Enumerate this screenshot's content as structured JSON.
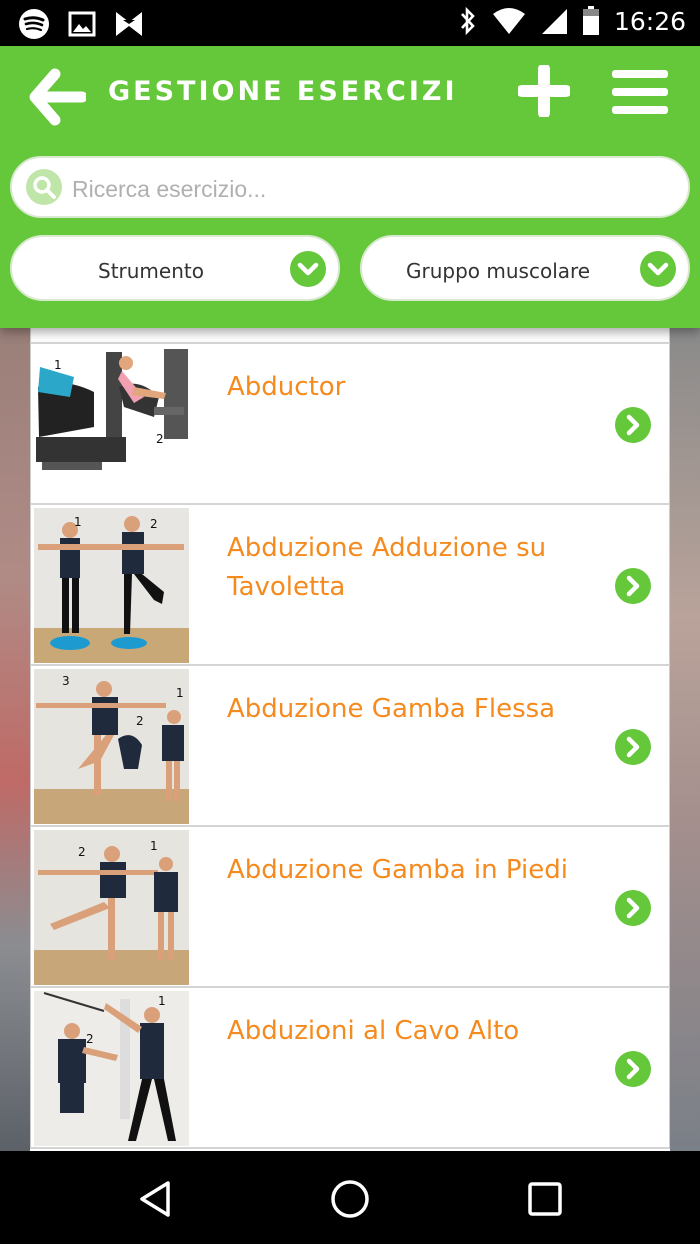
{
  "status_bar": {
    "time": "16:26",
    "icons": [
      "spotify-icon",
      "image-icon",
      "app-icon",
      "bluetooth-icon",
      "wifi-icon",
      "signal-icon",
      "battery-icon"
    ]
  },
  "header": {
    "title": "GESTIONE ESERCIZI",
    "background_color": "#65c73a",
    "icons": [
      "back-arrow-icon",
      "plus-icon",
      "hamburger-menu-icon"
    ]
  },
  "search": {
    "placeholder": "Ricerca esercizio...",
    "value": "",
    "icon": "search-icon"
  },
  "filters": [
    {
      "label": "Strumento",
      "icon": "chevron-down-icon"
    },
    {
      "label": "Gruppo muscolare",
      "icon": "chevron-down-icon"
    }
  ],
  "exercises": [
    {
      "name": "Abductor"
    },
    {
      "name": "Abduzione Adduzione su Tavoletta"
    },
    {
      "name": "Abduzione Gamba Flessa"
    },
    {
      "name": "Abduzione Gamba in Piedi"
    },
    {
      "name": "Abduzioni al Cavo Alto"
    }
  ],
  "item_title_color": "#f58a1f",
  "nav_bar": {
    "icons": [
      "back-triangle-icon",
      "home-circle-icon",
      "recents-square-icon"
    ]
  }
}
